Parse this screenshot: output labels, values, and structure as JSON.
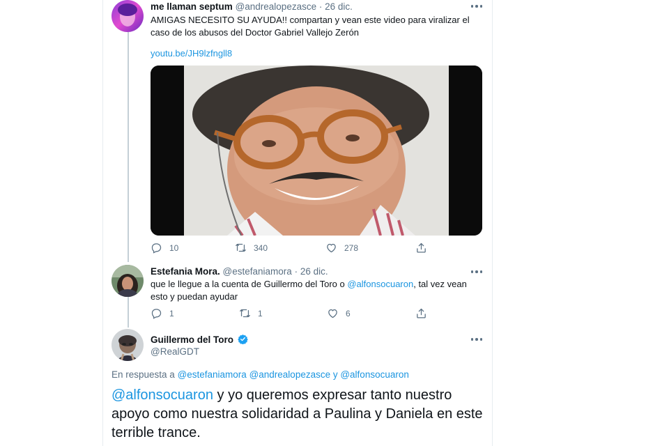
{
  "tweets": [
    {
      "name": "me llaman septum",
      "handle": "@andrealopezasce",
      "date": "· 26 dic.",
      "text": "AMIGAS NECESITO SU AYUDA!! compartan y vean este video para viralizar el caso de los abusos del Doctor Gabriel Vallejo Zerón",
      "link": "youtu.be/JH9lzfngll8",
      "replies": "10",
      "retweets": "340",
      "likes": "278"
    },
    {
      "name": "Estefania Mora.",
      "handle": "@estefaniamora",
      "date": "· 26 dic.",
      "text_before": "que le llegue a la cuenta de Guillermo del Toro o ",
      "mention": "@alfonsocuaron",
      "text_after": ", tal vez vean esto y puedan ayudar",
      "replies": "1",
      "retweets": "1",
      "likes": "6"
    }
  ],
  "main_tweet": {
    "name": "Guillermo del Toro",
    "handle": "@RealGDT",
    "reply_prefix": "En respuesta a ",
    "reply_mentions": "@estefaniamora @andrealopezasce y @alfonsocuaron",
    "mention": "@alfonsocuaron",
    "text": " y yo queremos expresar tanto nuestro apoyo como nuestra solidaridad a Paulina y Daniela en este terrible trance."
  },
  "icons": {
    "reply": "reply-icon",
    "retweet": "retweet-icon",
    "like": "heart-icon",
    "share": "share-icon",
    "more": "more-icon",
    "verified": "verified-badge-icon"
  },
  "colors": {
    "accent": "#1b95e0",
    "text": "#0f1419",
    "muted": "#5b7083",
    "verified": "#1da1f2"
  }
}
